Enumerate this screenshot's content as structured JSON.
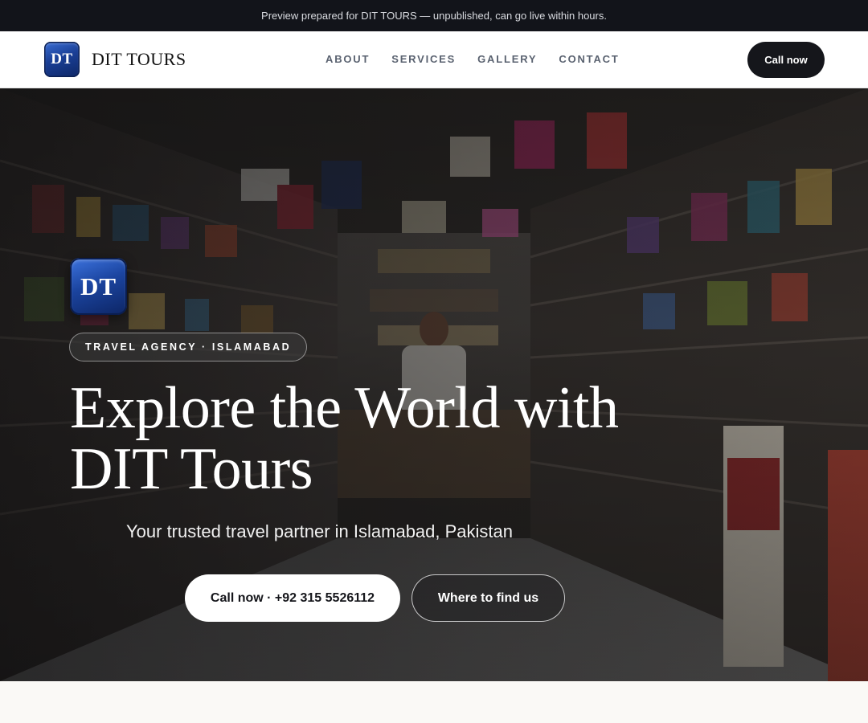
{
  "preview_banner": {
    "text": "Preview prepared for DIT TOURS — unpublished, can go live within hours."
  },
  "header": {
    "logo_text": "DT",
    "brand_name": "DIT TOURS",
    "nav": [
      {
        "label": "ABOUT"
      },
      {
        "label": "SERVICES"
      },
      {
        "label": "GALLERY"
      },
      {
        "label": "CONTACT"
      }
    ],
    "call_label": "Call now"
  },
  "hero": {
    "background_image": "shop-interior-photo",
    "logo_text": "DT",
    "badge": "TRAVEL AGENCY · ISLAMABAD",
    "title_line1": "Explore the World with",
    "title_line2": "DIT Tours",
    "subtitle": "Your trusted travel partner in Islamabad, Pakistan",
    "primary_button": "Call now · +92 315 5526112",
    "secondary_button": "Where to find us"
  },
  "colors": {
    "banner_bg": "#12141a",
    "logo_blue": "#1a3f96",
    "dark_button": "#15161b",
    "page_bg": "#faf9f6"
  }
}
